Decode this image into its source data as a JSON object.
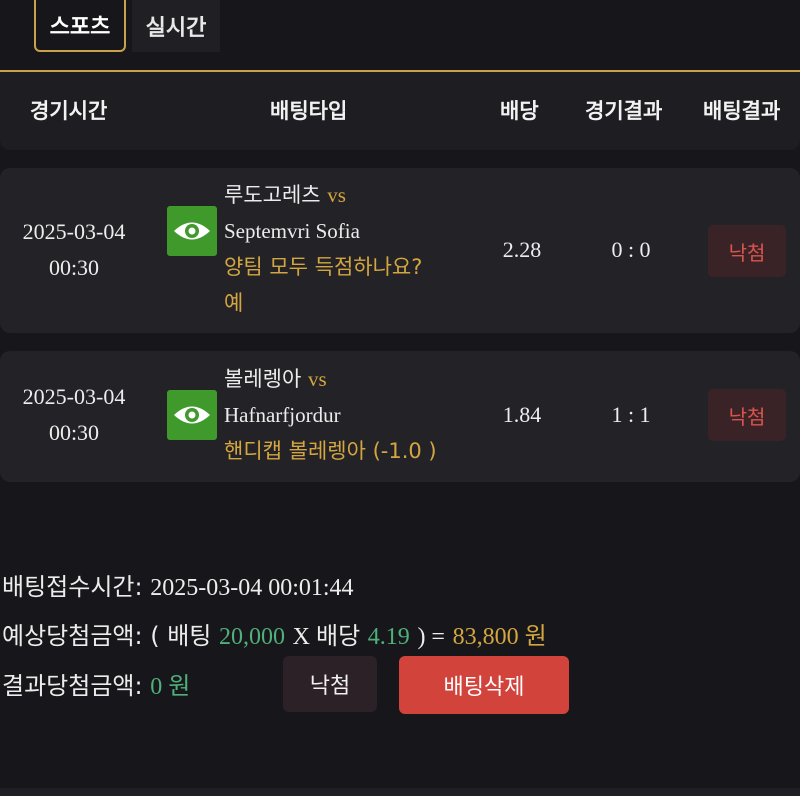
{
  "tabs": [
    {
      "label": "스포츠"
    },
    {
      "label": "실시간"
    }
  ],
  "columns": {
    "time": "경기시간",
    "bet_type": "배팅타입",
    "odds": "배당",
    "result": "경기결과",
    "bet_result": "배팅결과"
  },
  "rows": [
    {
      "date": "2025-03-04",
      "time": "00:30",
      "home": "루도고레츠",
      "vs": "vs",
      "away": "Septemvri Sofia",
      "market": "양팀 모두 득점하나요?",
      "pick": "예",
      "odds": "2.28",
      "score": "0 : 0",
      "status": "낙첨",
      "icon": "eye-icon"
    },
    {
      "date": "2025-03-04",
      "time": "00:30",
      "home": "볼레렝아",
      "vs": "vs",
      "away": "Hafnarfjordur",
      "market": "핸디캡 볼레렝아 (-1.0 )",
      "pick": "",
      "odds": "1.84",
      "score": "1 : 1",
      "status": "낙첨",
      "icon": "eye-icon"
    }
  ],
  "summary": {
    "received_label": "배팅접수시간:",
    "received_value": "2025-03-04 00:01:44",
    "expected_label": "예상당첨금액:",
    "open_paren": "( 배팅",
    "bet_amount": "20,000",
    "x_odds": "X 배당",
    "total_odds": "4.19",
    "close_eq": ") =",
    "expected_amount": "83,800 원",
    "result_label": "결과당첨금액:",
    "result_amount": "0 원"
  },
  "buttons": {
    "status": "낙첨",
    "delete": "배팅삭제"
  },
  "colors": {
    "gold": "#c9a24a",
    "green_icon": "#3f9a2b",
    "lose_red": "#d9544d",
    "delete_btn": "#d2433c",
    "amount_green": "#4fb07a"
  }
}
